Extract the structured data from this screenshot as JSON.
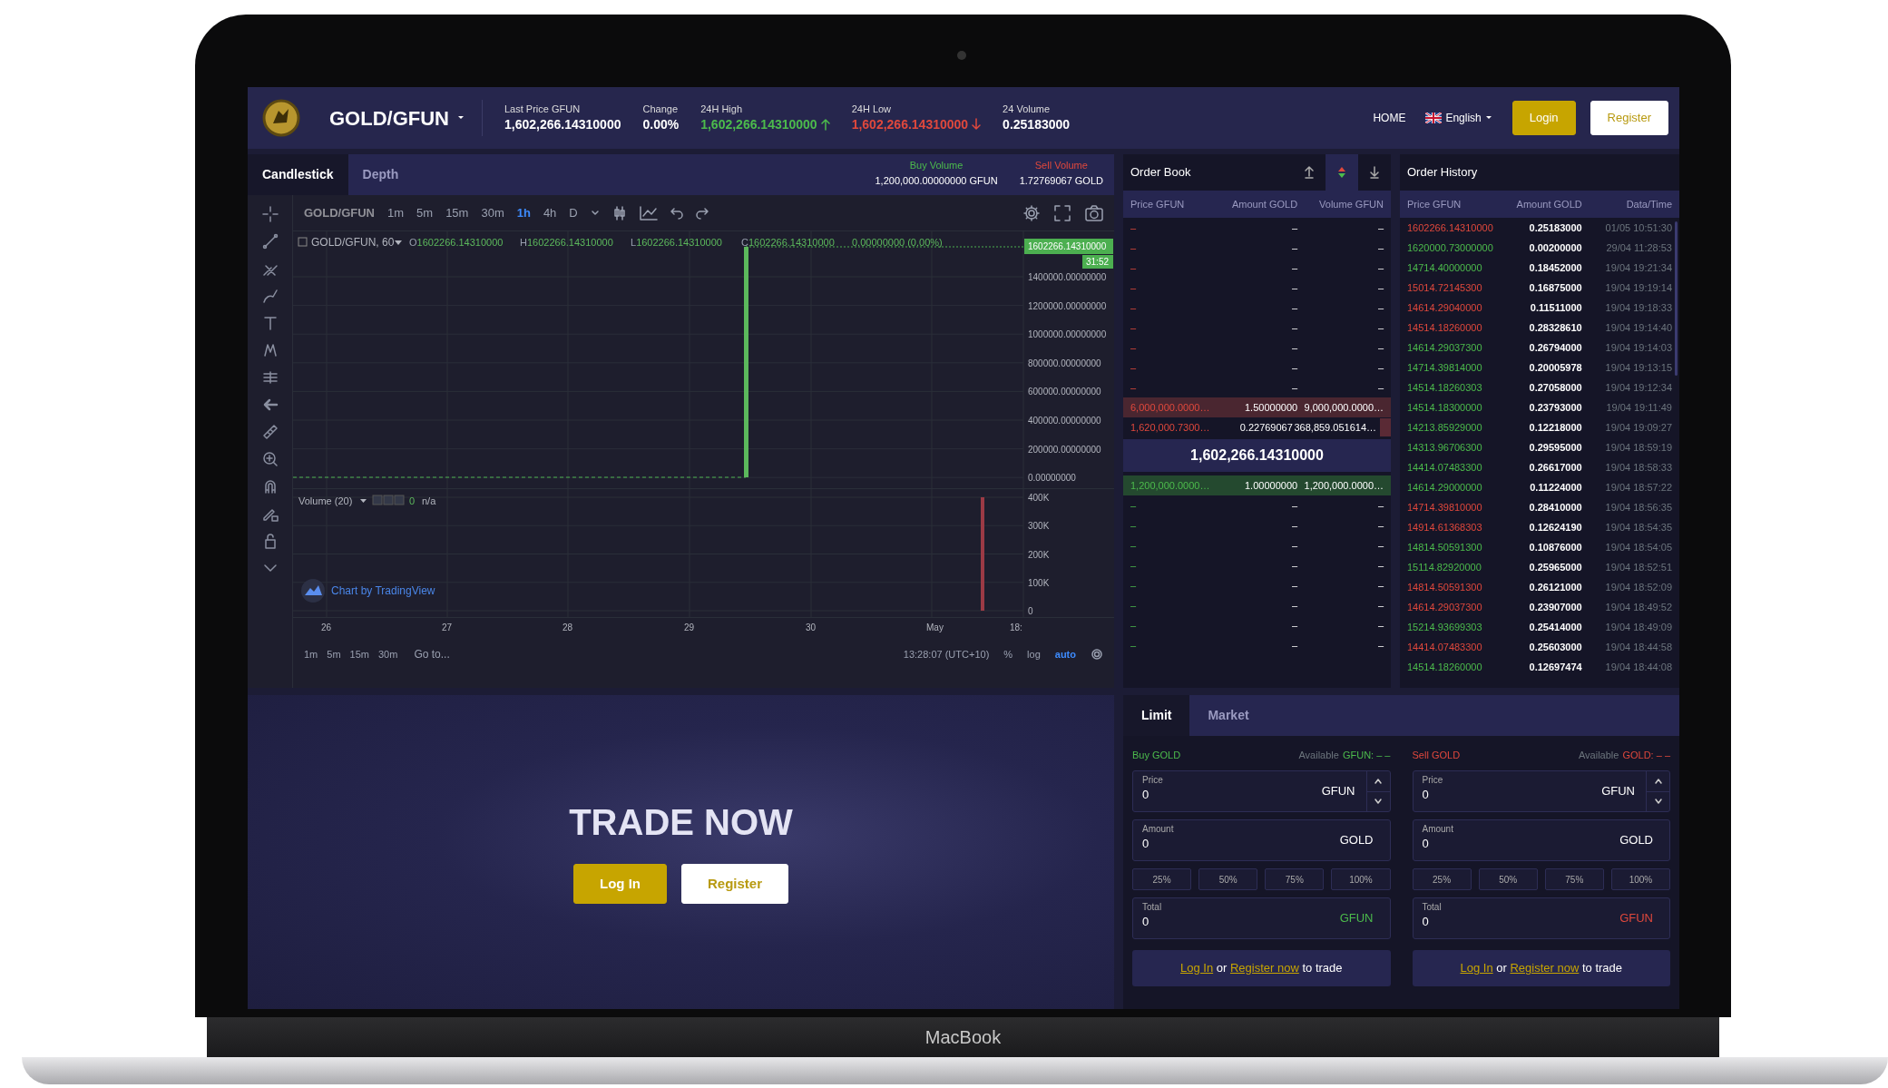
{
  "device": {
    "label": "MacBook"
  },
  "header": {
    "pair": "GOLD/GFUN",
    "stats": [
      {
        "label": "Last Price GFUN",
        "value": "1,602,266.14310000",
        "kind": "plain"
      },
      {
        "label": "Change",
        "value": "0.00%",
        "kind": "plain"
      },
      {
        "label": "24H High",
        "value": "1,602,266.14310000",
        "kind": "rising"
      },
      {
        "label": "24H Low",
        "value": "1,602,266.14310000",
        "kind": "falling"
      },
      {
        "label": "24 Volume",
        "value": "0.25183000",
        "kind": "plain"
      }
    ],
    "home": "HOME",
    "language": "English",
    "login": "Login",
    "register": "Register"
  },
  "chart_panel": {
    "tabs": [
      {
        "label": "Candlestick",
        "selected": true
      },
      {
        "label": "Depth",
        "selected": false
      }
    ],
    "buy_volume": {
      "label": "Buy Volume",
      "value": "1,200,000.00000000 GFUN"
    },
    "sell_volume": {
      "label": "Sell Volume",
      "value": "1.72769067 GOLD"
    },
    "symbol": "GOLD/GFUN",
    "intervals": [
      {
        "label": "1m",
        "selected": false
      },
      {
        "label": "5m",
        "selected": false
      },
      {
        "label": "15m",
        "selected": false
      },
      {
        "label": "30m",
        "selected": false
      },
      {
        "label": "1h",
        "selected": true
      },
      {
        "label": "4h",
        "selected": false
      },
      {
        "label": "D",
        "selected": false
      }
    ],
    "legend_title": "GOLD/GFUN, 60",
    "ohlc": [
      {
        "key": "O",
        "value": "1602266.14310000"
      },
      {
        "key": "H",
        "value": "1602266.14310000"
      },
      {
        "key": "L",
        "value": "1602266.14310000"
      },
      {
        "key": "C",
        "value": "1602266.14310000"
      }
    ],
    "change": "0.00000000 (0.00%)",
    "price_tag": "1602266.14310000",
    "countdown": "31:52",
    "price_ticks": [
      "1400000.00000000",
      "1200000.00000000",
      "1000000.00000000",
      "800000.00000000",
      "600000.00000000",
      "400000.00000000",
      "200000.00000000",
      "0.00000000"
    ],
    "volume_legend": {
      "title": "Volume (20)",
      "value": "0",
      "extra": "n/a"
    },
    "volume_ticks": [
      "400K",
      "300K",
      "200K",
      "100K",
      "0"
    ],
    "attribution": "Chart by TradingView",
    "date_ticks": [
      "26",
      "27",
      "28",
      "29",
      "30",
      "May",
      "18:"
    ],
    "range_buttons": [
      "1m",
      "5m",
      "15m",
      "30m"
    ],
    "goto": "Go to...",
    "clock": "13:28:07 (UTC+10)",
    "scale_options": [
      {
        "label": "%",
        "selected": false
      },
      {
        "label": "log",
        "selected": false
      },
      {
        "label": "auto",
        "selected": true
      }
    ]
  },
  "order_book": {
    "title": "Order Book",
    "views": [
      {
        "kind": "asks",
        "selected": false
      },
      {
        "kind": "both",
        "selected": true
      },
      {
        "kind": "bids",
        "selected": false
      }
    ],
    "columns": [
      "Price GFUN",
      "Amount GOLD",
      "Volume GFUN"
    ],
    "asks": [
      {
        "price": "–",
        "amount": "–",
        "volume": "–"
      },
      {
        "price": "–",
        "amount": "–",
        "volume": "–"
      },
      {
        "price": "–",
        "amount": "–",
        "volume": "–"
      },
      {
        "price": "–",
        "amount": "–",
        "volume": "–"
      },
      {
        "price": "–",
        "amount": "–",
        "volume": "–"
      },
      {
        "price": "–",
        "amount": "–",
        "volume": "–"
      },
      {
        "price": "–",
        "amount": "–",
        "volume": "–"
      },
      {
        "price": "–",
        "amount": "–",
        "volume": "–"
      },
      {
        "price": "–",
        "amount": "–",
        "volume": "–"
      },
      {
        "price": "6,000,000.0000…",
        "amount": "1.50000000",
        "volume": "9,000,000.0000…",
        "highlighted": true
      },
      {
        "price": "1,620,000.7300…",
        "amount": "0.22769067",
        "volume": "368,859.051614…",
        "level": 0.04
      }
    ],
    "last_price": "1,602,266.14310000",
    "bids": [
      {
        "price": "1,200,000.0000…",
        "amount": "1.00000000",
        "volume": "1,200,000.0000…",
        "highlighted": true
      },
      {
        "price": "–",
        "amount": "–",
        "volume": "–"
      },
      {
        "price": "–",
        "amount": "–",
        "volume": "–"
      },
      {
        "price": "–",
        "amount": "–",
        "volume": "–"
      },
      {
        "price": "–",
        "amount": "–",
        "volume": "–"
      },
      {
        "price": "–",
        "amount": "–",
        "volume": "–"
      },
      {
        "price": "–",
        "amount": "–",
        "volume": "–"
      },
      {
        "price": "–",
        "amount": "–",
        "volume": "–"
      },
      {
        "price": "–",
        "amount": "–",
        "volume": "–"
      }
    ]
  },
  "order_history": {
    "title": "Order History",
    "columns": [
      "Price GFUN",
      "Amount GOLD",
      "Data/Time"
    ],
    "rows": [
      {
        "color": "#e0483c",
        "price": "1602266.14310000",
        "amount": "0.25183000",
        "time": "01/05 10:51:30"
      },
      {
        "color": "#4cbb4c",
        "price": "1620000.73000000",
        "amount": "0.00200000",
        "time": "29/04 11:28:53"
      },
      {
        "color": "#4cbb4c",
        "price": "14714.40000000",
        "amount": "0.18452000",
        "time": "19/04 19:21:34"
      },
      {
        "color": "#e0483c",
        "price": "15014.72145300",
        "amount": "0.16875000",
        "time": "19/04 19:19:14"
      },
      {
        "color": "#e0483c",
        "price": "14614.29040000",
        "amount": "0.11511000",
        "time": "19/04 19:18:33"
      },
      {
        "color": "#e0483c",
        "price": "14514.18260000",
        "amount": "0.28328610",
        "time": "19/04 19:14:40"
      },
      {
        "color": "#4cbb4c",
        "price": "14614.29037300",
        "amount": "0.26794000",
        "time": "19/04 19:14:03"
      },
      {
        "color": "#4cbb4c",
        "price": "14714.39814000",
        "amount": "0.20005978",
        "time": "19/04 19:13:15"
      },
      {
        "color": "#4cbb4c",
        "price": "14514.18260303",
        "amount": "0.27058000",
        "time": "19/04 19:12:34"
      },
      {
        "color": "#4cbb4c",
        "price": "14514.18300000",
        "amount": "0.23793000",
        "time": "19/04 19:11:49"
      },
      {
        "color": "#4cbb4c",
        "price": "14213.85929000",
        "amount": "0.12218000",
        "time": "19/04 19:09:27"
      },
      {
        "color": "#4cbb4c",
        "price": "14313.96706300",
        "amount": "0.29595000",
        "time": "19/04 18:59:19"
      },
      {
        "color": "#4cbb4c",
        "price": "14414.07483300",
        "amount": "0.26617000",
        "time": "19/04 18:58:33"
      },
      {
        "color": "#4cbb4c",
        "price": "14614.29000000",
        "amount": "0.11224000",
        "time": "19/04 18:57:22"
      },
      {
        "color": "#e0483c",
        "price": "14714.39810000",
        "amount": "0.28410000",
        "time": "19/04 18:56:35"
      },
      {
        "color": "#e0483c",
        "price": "14914.61368303",
        "amount": "0.12624190",
        "time": "19/04 18:54:35"
      },
      {
        "color": "#4cbb4c",
        "price": "14814.50591300",
        "amount": "0.10876000",
        "time": "19/04 18:54:05"
      },
      {
        "color": "#4cbb4c",
        "price": "15114.82920000",
        "amount": "0.25965000",
        "time": "19/04 18:52:51"
      },
      {
        "color": "#e0483c",
        "price": "14814.50591300",
        "amount": "0.26121000",
        "time": "19/04 18:52:09"
      },
      {
        "color": "#e0483c",
        "price": "14614.29037300",
        "amount": "0.23907000",
        "time": "19/04 18:49:52"
      },
      {
        "color": "#4cbb4c",
        "price": "15214.93699303",
        "amount": "0.25414000",
        "time": "19/04 18:49:09"
      },
      {
        "color": "#e0483c",
        "price": "14414.07483300",
        "amount": "0.25603000",
        "time": "19/04 18:44:58"
      },
      {
        "color": "#4cbb4c",
        "price": "14514.18260000",
        "amount": "0.12697474",
        "time": "19/04 18:44:08"
      }
    ]
  },
  "banner": {
    "title": "TRADE NOW",
    "login": "Log In",
    "register": "Register"
  },
  "trade": {
    "tabs": [
      {
        "label": "Limit",
        "selected": true
      },
      {
        "label": "Market",
        "selected": false
      }
    ],
    "forms": [
      {
        "kind": "buy",
        "title": "Buy GOLD",
        "available_label": "Available",
        "available_value": "GFUN: – –",
        "rows": [
          {
            "kind": "field",
            "label": "Price",
            "value": "0",
            "unit": "GFUN",
            "stepper": true,
            "accent_unit": false
          },
          {
            "kind": "field",
            "label": "Amount",
            "value": "0",
            "unit": "GOLD",
            "stepper": false,
            "accent_unit": false
          },
          {
            "kind": "percents",
            "options": [
              "25%",
              "50%",
              "75%",
              "100%"
            ]
          },
          {
            "kind": "field",
            "label": "Total",
            "value": "0",
            "unit": "GFUN",
            "stepper": false,
            "accent_unit": true
          }
        ],
        "login_link": "Log In",
        "or": "or",
        "register_link": "Register now",
        "suffix": "to trade"
      },
      {
        "kind": "sell",
        "title": "Sell GOLD",
        "available_label": "Available",
        "available_value": "GOLD: – –",
        "rows": [
          {
            "kind": "field",
            "label": "Price",
            "value": "0",
            "unit": "GFUN",
            "stepper": true,
            "accent_unit": false
          },
          {
            "kind": "field",
            "label": "Amount",
            "value": "0",
            "unit": "GOLD",
            "stepper": false,
            "accent_unit": false
          },
          {
            "kind": "percents",
            "options": [
              "25%",
              "50%",
              "75%",
              "100%"
            ]
          },
          {
            "kind": "field",
            "label": "Total",
            "value": "0",
            "unit": "GFUN",
            "stepper": false,
            "accent_unit": true
          }
        ],
        "login_link": "Log In",
        "or": "or",
        "register_link": "Register now",
        "suffix": "to trade"
      }
    ]
  }
}
